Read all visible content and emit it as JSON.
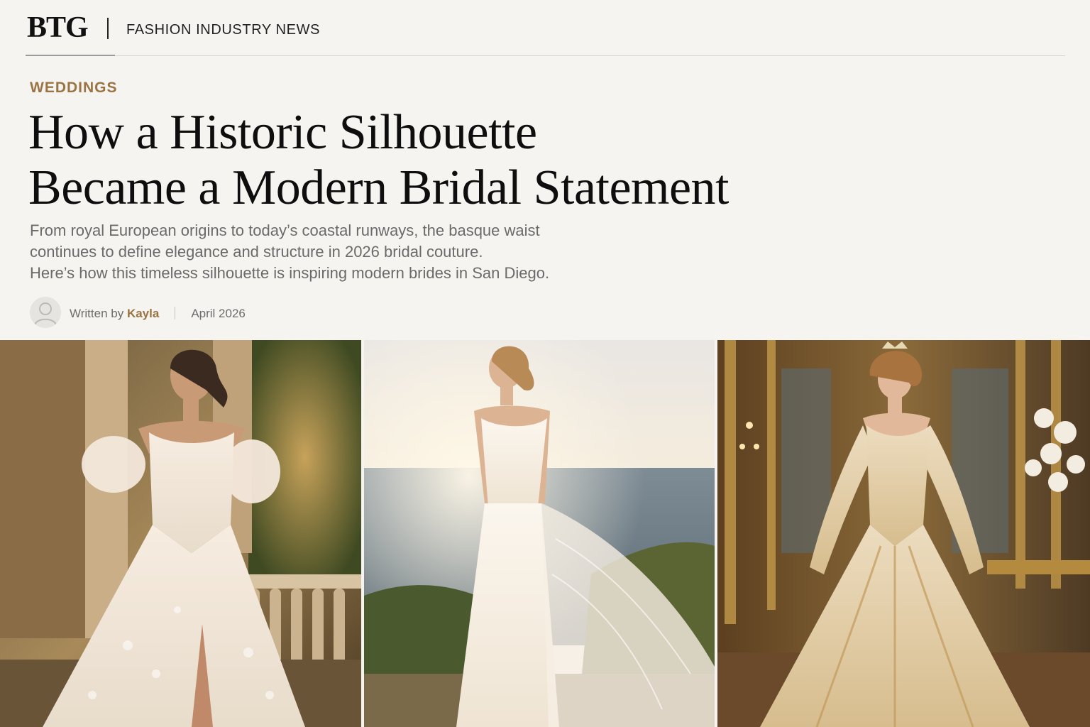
{
  "site": {
    "logo": "BTG",
    "section": "FASHION INDUSTRY NEWS"
  },
  "article": {
    "category": "WEDDINGS",
    "headline_lines": [
      "How a Historic Silhouette",
      "Became a Modern Bridal Statement"
    ],
    "dek_lines": [
      "From royal European origins to today’s coastal runways, the basque waist",
      "continues to define elegance and structure in 2026 bridal couture.",
      "Here’s how this timeless silhouette is inspiring modern brides in San Diego."
    ],
    "byline": {
      "written_by": "Written by",
      "author": "Kayla",
      "date": "April 2026"
    }
  },
  "images": [
    {
      "icon": "photo-bride-balcony"
    },
    {
      "icon": "photo-bride-ocean"
    },
    {
      "icon": "photo-bride-palace"
    }
  ],
  "colors": {
    "accent": "#9a7443",
    "background": "#f6f4f1",
    "headline": "#0e0e0e",
    "body": "#6a6a6a"
  }
}
